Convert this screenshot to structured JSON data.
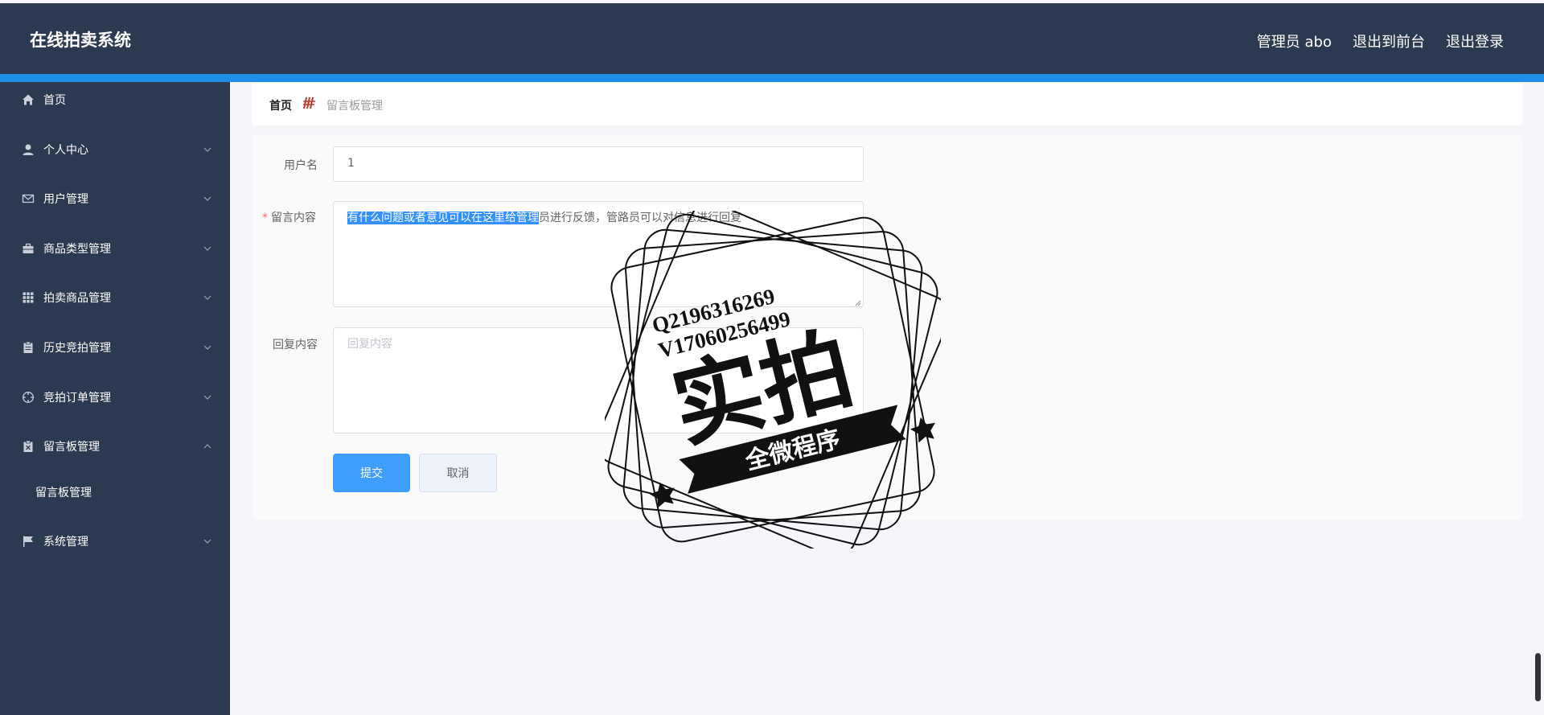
{
  "header": {
    "app_title": "在线拍卖系统",
    "links": [
      "管理员 abo",
      "退出到前台",
      "退出登录"
    ]
  },
  "sidebar": {
    "items": [
      {
        "label": "首页",
        "icon": "home-icon"
      },
      {
        "label": "个人中心",
        "icon": "user-icon"
      },
      {
        "label": "用户管理",
        "icon": "mail-icon"
      },
      {
        "label": "商品类型管理",
        "icon": "briefcase-icon"
      },
      {
        "label": "拍卖商品管理",
        "icon": "grid-icon"
      },
      {
        "label": "历史竞拍管理",
        "icon": "clipboard-icon"
      },
      {
        "label": "竞拍订单管理",
        "icon": "target-icon"
      },
      {
        "label": "留言板管理",
        "icon": "clipboard-x-icon"
      },
      {
        "label": "系统管理",
        "icon": "flag-icon"
      }
    ],
    "submenu": {
      "label": "留言板管理"
    }
  },
  "breadcrumb": {
    "home": "首页",
    "current": "留言板管理"
  },
  "form": {
    "username_label": "用户名",
    "username_value": "1",
    "message_label": "留言内容",
    "message_selected": "有什么问题或者意见可以在这里给管理",
    "message_rest": "员进行反馈，管路员可以对信息进行回复",
    "reply_label": "回复内容",
    "reply_placeholder": "回复内容",
    "submit_label": "提交",
    "cancel_label": "取消"
  },
  "watermark": {
    "line1": "Q2196316269",
    "line2": "V17060256499",
    "big": "实拍",
    "banner": "全微程序"
  },
  "colors": {
    "header_bg": "#2b3a51",
    "accent": "#1f8ee8",
    "primary_button": "#409eff",
    "required_mark": "#f56c6c"
  }
}
